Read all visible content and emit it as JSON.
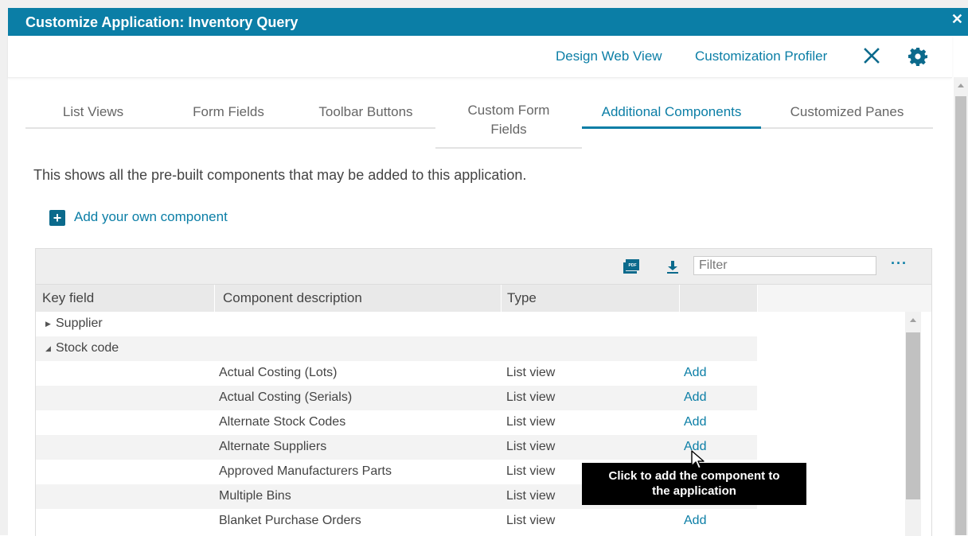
{
  "window": {
    "title": "Customize Application: Inventory Query",
    "close_glyph": "✕"
  },
  "toplinks": {
    "design_web_view": "Design Web View",
    "customization_profiler": "Customization Profiler"
  },
  "icons": {
    "close": "close-icon",
    "settings": "gear-icon",
    "pdf": "pdf-export-icon",
    "download": "download-icon"
  },
  "tabs": [
    {
      "label": "List Views"
    },
    {
      "label": "Form Fields"
    },
    {
      "label": "Toolbar Buttons"
    },
    {
      "label": "Custom Form Fields"
    },
    {
      "label": "Additional Components",
      "active": true
    },
    {
      "label": "Customized Panes"
    }
  ],
  "description": "This shows all the pre-built components that may be added to this application.",
  "add_own": {
    "label": "Add your own component",
    "icon": "+"
  },
  "grid": {
    "filter_placeholder": "Filter",
    "more": "···",
    "columns": [
      "Key field",
      "Component description",
      "Type"
    ],
    "groups": [
      {
        "label": "Supplier",
        "expanded": false
      },
      {
        "label": "Stock code",
        "expanded": true
      }
    ],
    "rows": [
      {
        "description": "Actual Costing (Lots)",
        "type": "List view",
        "action": "Add"
      },
      {
        "description": "Actual Costing (Serials)",
        "type": "List view",
        "action": "Add"
      },
      {
        "description": "Alternate Stock Codes",
        "type": "List view",
        "action": "Add"
      },
      {
        "description": "Alternate Suppliers",
        "type": "List view",
        "action": "Add"
      },
      {
        "description": "Approved Manufacturers Parts",
        "type": "List view",
        "action": ""
      },
      {
        "description": "Multiple Bins",
        "type": "List view",
        "action": ""
      },
      {
        "description": "Blanket Purchase Orders",
        "type": "List view",
        "action": "Add"
      }
    ]
  },
  "tooltip": {
    "line1": "Click to add the component to",
    "line2": "the application"
  },
  "colors": {
    "accent": "#0b7ea6",
    "titlebar": "#0b7ea6",
    "tooltip_bg": "#000000"
  }
}
